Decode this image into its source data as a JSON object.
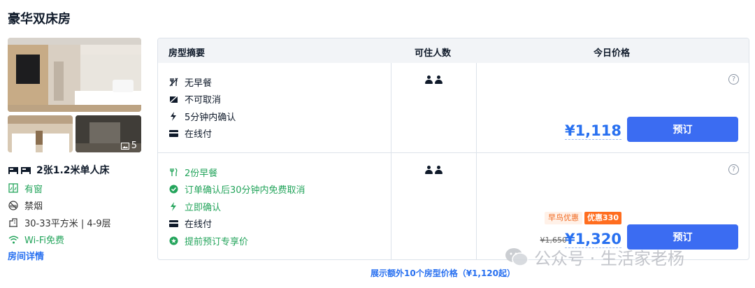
{
  "room": {
    "title": "豪华双床房",
    "photo_count": "5",
    "bed": "2张1.2米单人床",
    "window": "有窗",
    "smoking": "禁烟",
    "area_floor": "30-33平方米 | 4-9层",
    "wifi": "Wi-Fi免费",
    "detail_link": "房间详情"
  },
  "table": {
    "headers": [
      "房型摘要",
      "可住人数",
      "今日价格"
    ],
    "rows": [
      {
        "policies": [
          "无早餐",
          "不可取消",
          "5分钟内确认",
          "在线付"
        ],
        "price": "¥1,118",
        "book_label": "预订"
      },
      {
        "policies": [
          "2份早餐",
          "订单确认后30分钟内免费取消",
          "立即确认",
          "在线付",
          "提前预订专享价"
        ],
        "early_bird": "早鸟优惠",
        "discount": "优惠330",
        "original_price": "¥1,650",
        "price": "¥1,320",
        "book_label": "预订"
      }
    ]
  },
  "more_link": "展示额外10个房型价格（¥1,120起）",
  "watermark": "公众号 · 生活家老杨",
  "colors": {
    "accent": "#2870f0",
    "button": "#3b6cf2",
    "green": "#23a45b",
    "orange": "#ff6d1f"
  }
}
